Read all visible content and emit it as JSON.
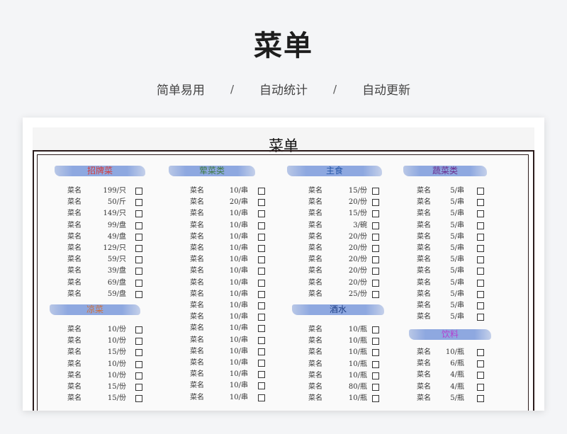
{
  "header": {
    "title": "菜单",
    "features": [
      "简单易用",
      "自动统计",
      "自动更新"
    ],
    "separator": "/"
  },
  "document": {
    "title": "菜单",
    "sections": [
      {
        "name": "招牌菜",
        "color": "#d43b3b",
        "items": [
          {
            "name": "菜名",
            "price": "199/只"
          },
          {
            "name": "菜名",
            "price": "50/斤"
          },
          {
            "name": "菜名",
            "price": "149/只"
          },
          {
            "name": "菜名",
            "price": "99/盘"
          },
          {
            "name": "菜名",
            "price": "49/盘"
          },
          {
            "name": "菜名",
            "price": "129/只"
          },
          {
            "name": "菜名",
            "price": "59/只"
          },
          {
            "name": "菜名",
            "price": "39/盘"
          },
          {
            "name": "菜名",
            "price": "69/盘"
          },
          {
            "name": "菜名",
            "price": "59/盘"
          }
        ]
      },
      {
        "name": "凉菜",
        "color": "#d0703a",
        "items": [
          {
            "name": "菜名",
            "price": "10/份"
          },
          {
            "name": "菜名",
            "price": "10/份"
          },
          {
            "name": "菜名",
            "price": "15/份"
          },
          {
            "name": "菜名",
            "price": "10/份"
          },
          {
            "name": "菜名",
            "price": "10/份"
          },
          {
            "name": "菜名",
            "price": "15/份"
          },
          {
            "name": "菜名",
            "price": "15/份"
          }
        ]
      },
      {
        "name": "荤菜类",
        "color": "#3f7a44",
        "items": [
          {
            "name": "菜名",
            "price": "10/串"
          },
          {
            "name": "菜名",
            "price": "20/串"
          },
          {
            "name": "菜名",
            "price": "10/串"
          },
          {
            "name": "菜名",
            "price": "10/串"
          },
          {
            "name": "菜名",
            "price": "10/串"
          },
          {
            "name": "菜名",
            "price": "10/串"
          },
          {
            "name": "菜名",
            "price": "10/串"
          },
          {
            "name": "菜名",
            "price": "10/串"
          },
          {
            "name": "菜名",
            "price": "10/串"
          },
          {
            "name": "菜名",
            "price": "10/串"
          },
          {
            "name": "菜名",
            "price": "10/串"
          },
          {
            "name": "菜名",
            "price": "10/串"
          },
          {
            "name": "菜名",
            "price": "10/串"
          },
          {
            "name": "菜名",
            "price": "10/串"
          },
          {
            "name": "菜名",
            "price": "10/串"
          },
          {
            "name": "菜名",
            "price": "10/串"
          },
          {
            "name": "菜名",
            "price": "10/串"
          },
          {
            "name": "菜名",
            "price": "10/串"
          },
          {
            "name": "菜名",
            "price": "10/串"
          }
        ]
      },
      {
        "name": "主食",
        "color": "#2657a8",
        "items": [
          {
            "name": "菜名",
            "price": "15/份"
          },
          {
            "name": "菜名",
            "price": "20/份"
          },
          {
            "name": "菜名",
            "price": "15/份"
          },
          {
            "name": "菜名",
            "price": "3/碗"
          },
          {
            "name": "菜名",
            "price": "20/份"
          },
          {
            "name": "菜名",
            "price": "20/份"
          },
          {
            "name": "菜名",
            "price": "20/份"
          },
          {
            "name": "菜名",
            "price": "20/份"
          },
          {
            "name": "菜名",
            "price": "20/份"
          },
          {
            "name": "菜名",
            "price": "25/份"
          }
        ]
      },
      {
        "name": "酒水",
        "color": "#1f3f86",
        "items": [
          {
            "name": "菜名",
            "price": "10/瓶"
          },
          {
            "name": "菜名",
            "price": "10/瓶"
          },
          {
            "name": "菜名",
            "price": "10/瓶"
          },
          {
            "name": "菜名",
            "price": "10/瓶"
          },
          {
            "name": "菜名",
            "price": "10/瓶"
          },
          {
            "name": "菜名",
            "price": "80/瓶"
          },
          {
            "name": "菜名",
            "price": "10/瓶"
          }
        ]
      },
      {
        "name": "蔬菜类",
        "color": "#6a2a8c",
        "items": [
          {
            "name": "菜名",
            "price": "5/串"
          },
          {
            "name": "菜名",
            "price": "5/串"
          },
          {
            "name": "菜名",
            "price": "5/串"
          },
          {
            "name": "菜名",
            "price": "5/串"
          },
          {
            "name": "菜名",
            "price": "5/串"
          },
          {
            "name": "菜名",
            "price": "5/串"
          },
          {
            "name": "菜名",
            "price": "5/串"
          },
          {
            "name": "菜名",
            "price": "5/串"
          },
          {
            "name": "菜名",
            "price": "5/串"
          },
          {
            "name": "菜名",
            "price": "5/串"
          },
          {
            "name": "菜名",
            "price": "5/串"
          },
          {
            "name": "菜名",
            "price": "5/串"
          }
        ]
      },
      {
        "name": "饮料",
        "color": "#b53fd0",
        "items": [
          {
            "name": "菜名",
            "price": "10/瓶"
          },
          {
            "name": "菜名",
            "price": "6/瓶"
          },
          {
            "name": "菜名",
            "price": "4/瓶"
          },
          {
            "name": "菜名",
            "price": "4/瓶"
          },
          {
            "name": "菜名",
            "price": "5/瓶"
          }
        ]
      }
    ]
  }
}
